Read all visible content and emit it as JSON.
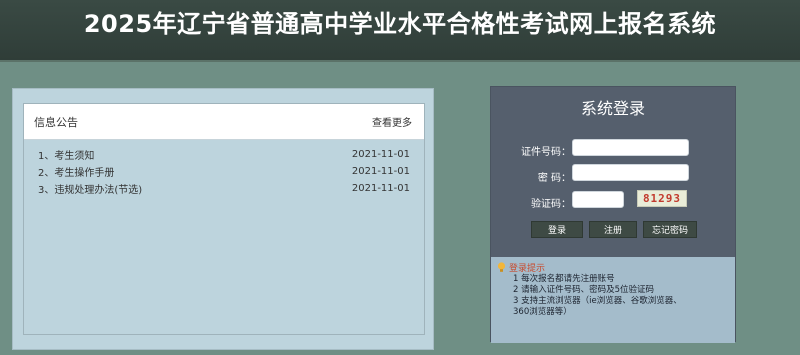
{
  "header": {
    "title": "2025年辽宁省普通高中学业水平合格性考试网上报名系统"
  },
  "notice": {
    "title": "信息公告",
    "more": "查看更多",
    "items": [
      {
        "label": "1、考生须知",
        "date": "2021-11-01"
      },
      {
        "label": "2、考生操作手册",
        "date": "2021-11-01"
      },
      {
        "label": "3、违规处理办法(节选)",
        "date": "2021-11-01"
      }
    ]
  },
  "login": {
    "title": "系统登录",
    "id_label": "证件号码：",
    "id_value": "",
    "password_label": "密  码：",
    "password_value": "",
    "captcha_label": "验证码：",
    "captcha_value": "",
    "captcha_image_text": "81293",
    "buttons": {
      "login": "登录",
      "register": "注册",
      "forgot": "忘记密码"
    },
    "tips": {
      "title": "登录提示",
      "lines": [
        "1 每次报名都请先注册账号",
        "2 请输入证件号码、密码及5位验证码",
        "3 支持主流浏览器（ie浏览器、谷歌浏览器、",
        "360浏览器等）"
      ]
    }
  },
  "colors": {
    "background": "#6f8f85",
    "header": "#2f3d38",
    "login_panel": "#555f6d",
    "notice_panel": "#bdd4dd",
    "tips_bg": "#a4bccb",
    "captcha_text": "#c23a2e"
  }
}
